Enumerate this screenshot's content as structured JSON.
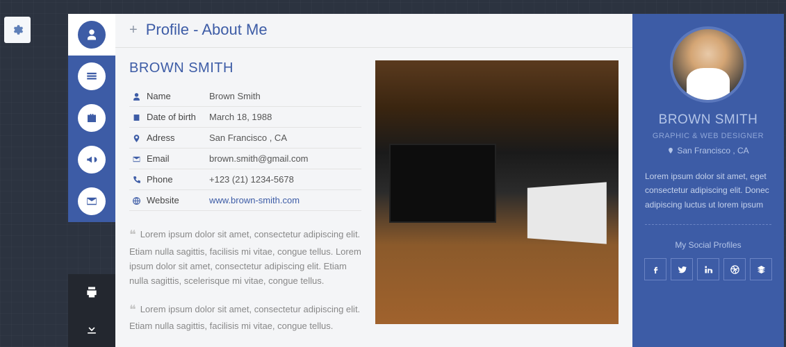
{
  "header": {
    "title": "Profile - About Me"
  },
  "nav": {
    "items": [
      {
        "name": "profile",
        "active": true
      },
      {
        "name": "resume",
        "active": false
      },
      {
        "name": "portfolio",
        "active": false
      },
      {
        "name": "blog",
        "active": false
      },
      {
        "name": "contact",
        "active": false
      }
    ],
    "print": "Print",
    "download": "Download"
  },
  "profile": {
    "name_heading": "BROWN SMITH",
    "rows": [
      {
        "icon": "user",
        "label": "Name",
        "value": "Brown Smith"
      },
      {
        "icon": "calendar",
        "label": "Date of birth",
        "value": "March 18, 1988"
      },
      {
        "icon": "pin",
        "label": "Adress",
        "value": "San Francisco , CA"
      },
      {
        "icon": "envelope",
        "label": "Email",
        "value": "brown.smith@gmail.com"
      },
      {
        "icon": "phone",
        "label": "Phone",
        "value": "+123 (21) 1234-5678"
      },
      {
        "icon": "globe",
        "label": "Website",
        "value": "www.brown-smith.com",
        "link": true
      }
    ],
    "para1": "Lorem ipsum dolor sit amet, consectetur adipiscing elit. Etiam nulla sagittis, facilisis mi vitae, congue tellus. Lorem ipsum dolor sit amet, consectetur adipiscing elit. Etiam nulla sagittis, scelerisque mi vitae, congue tellus.",
    "para2": "Lorem ipsum dolor sit amet, consectetur adipiscing elit. Etiam nulla sagittis, facilisis mi vitae, congue tellus."
  },
  "sidebar": {
    "name": "BROWN SMITH",
    "role": "GRAPHIC & WEB DESIGNER",
    "location": "San Francisco , CA",
    "bio": "Lorem ipsum dolor sit amet, eget consectetur adipiscing elit. Donec adipiscing luctus ut lorem ipsum",
    "social_heading": "My Social Profiles",
    "social": [
      "facebook",
      "twitter",
      "linkedin",
      "dribbble",
      "layers"
    ]
  }
}
